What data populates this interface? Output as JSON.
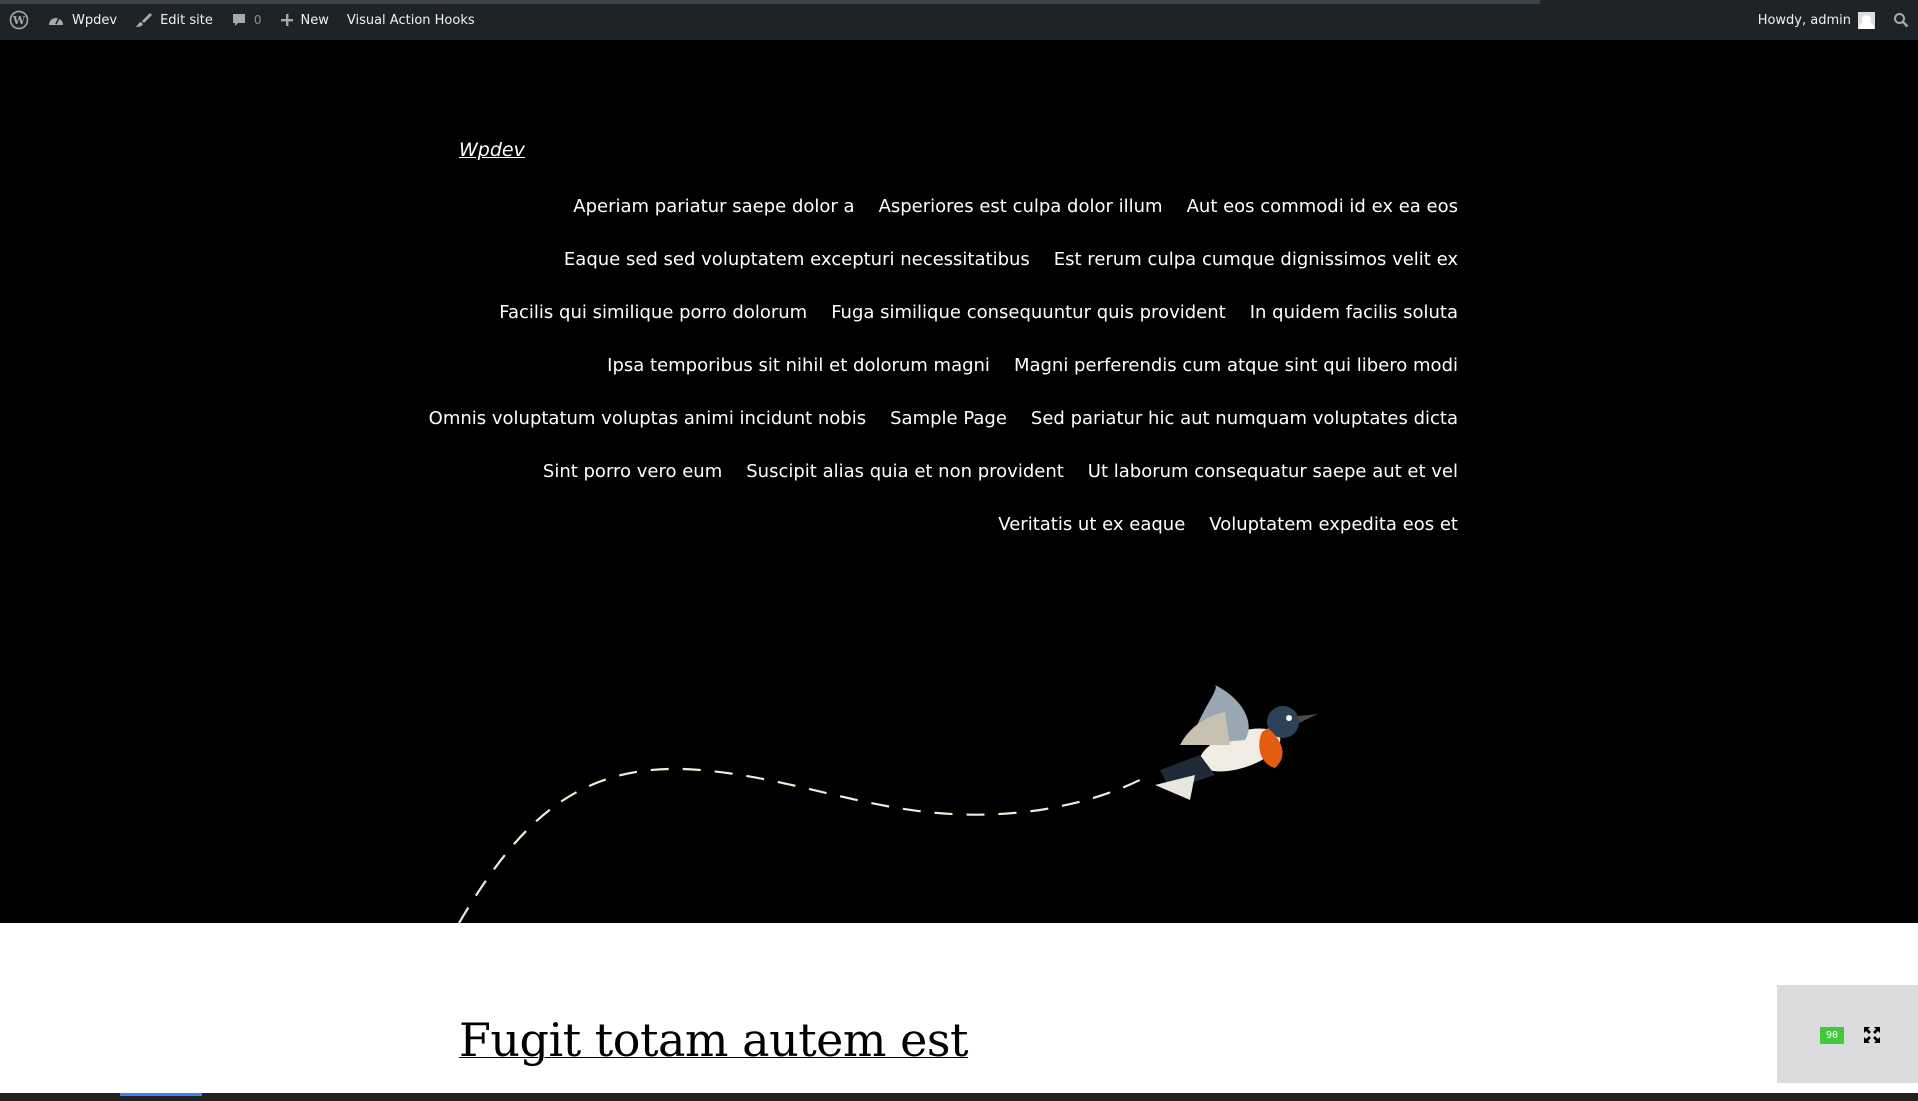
{
  "adminbar": {
    "site_name": "Wpdev",
    "edit_site": "Edit site",
    "comments_count": "0",
    "new_label": "New",
    "plugin_label": "Visual Action Hooks",
    "howdy": "Howdy, admin"
  },
  "site": {
    "title": "Wpdev"
  },
  "nav": {
    "rows": [
      [
        "Aperiam pariatur saepe dolor a",
        "Asperiores est culpa dolor illum",
        "Aut eos commodi id ex ea eos"
      ],
      [
        "Eaque sed sed voluptatem excepturi necessitatibus",
        "Est rerum culpa cumque dignissimos velit ex"
      ],
      [
        "Facilis qui similique porro dolorum",
        "Fuga similique consequuntur quis provident",
        "In quidem facilis soluta"
      ],
      [
        "Ipsa temporibus sit nihil et dolorum magni",
        "Magni perferendis cum atque sint qui libero modi"
      ],
      [
        "Omnis voluptatum voluptas animi incidunt nobis",
        "Sample Page",
        "Sed pariatur hic aut numquam voluptates dicta"
      ],
      [
        "Sint porro vero eum",
        "Suscipit alias quia et non provident",
        "Ut laborum consequatur saepe aut et vel"
      ],
      [
        "Veritatis ut ex eaque",
        "Voluptatem expedita eos et"
      ]
    ]
  },
  "post": {
    "title": "Fugit totam autem est"
  },
  "widget": {
    "badge": "90"
  },
  "colors": {
    "adminbar_bg": "#1d2327",
    "hero_bg": "#000000",
    "badge": "#3ec93e"
  }
}
